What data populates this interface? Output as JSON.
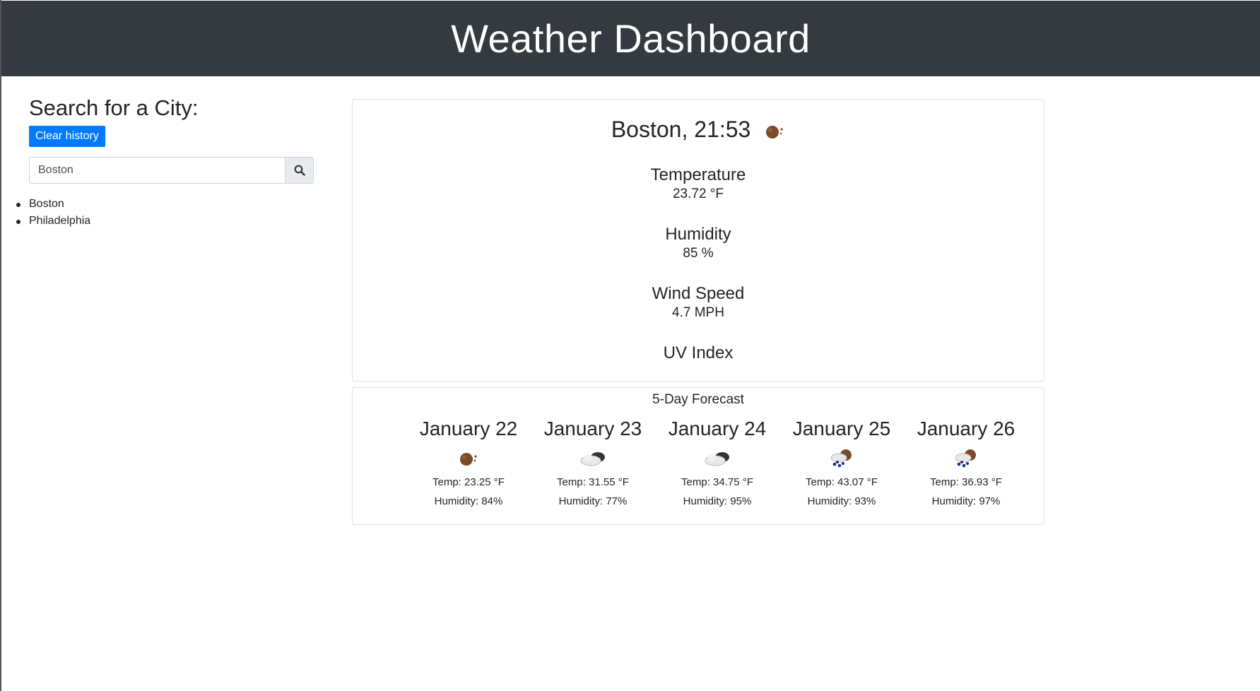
{
  "header": {
    "title": "Weather Dashboard"
  },
  "sidebar": {
    "heading": "Search for a City:",
    "clear_button_label": "Clear history",
    "search": {
      "value": "Boston",
      "placeholder": "",
      "button_icon": "search-icon"
    },
    "history": [
      "Boston",
      "Philadelphia"
    ]
  },
  "current": {
    "title": "Boston, 21:53",
    "icon": "moon-night-icon",
    "temperature": {
      "label": "Temperature",
      "value": "23.72 °F"
    },
    "humidity": {
      "label": "Humidity",
      "value": "85 %"
    },
    "wind": {
      "label": "Wind Speed",
      "value": "4.7 MPH"
    },
    "uv": {
      "label": "UV Index",
      "value": ""
    }
  },
  "forecast": {
    "title": "5-Day Forecast",
    "days": [
      {
        "date": "January 22",
        "icon": "moon-night-icon",
        "temp": "Temp: 23.25 °F",
        "humidity": "Humidity: 84%"
      },
      {
        "date": "January 23",
        "icon": "cloud-icon",
        "temp": "Temp: 31.55 °F",
        "humidity": "Humidity: 77%"
      },
      {
        "date": "January 24",
        "icon": "cloud-icon",
        "temp": "Temp: 34.75 °F",
        "humidity": "Humidity: 95%"
      },
      {
        "date": "January 25",
        "icon": "rain-night-icon",
        "temp": "Temp: 43.07 °F",
        "humidity": "Humidity: 93%"
      },
      {
        "date": "January 26",
        "icon": "rain-night-icon",
        "temp": "Temp: 36.93 °F",
        "humidity": "Humidity: 97%"
      }
    ]
  },
  "colors": {
    "header_bg": "#343a40",
    "primary": "#007bff",
    "text": "#212529",
    "border": "#dfe2e6"
  }
}
